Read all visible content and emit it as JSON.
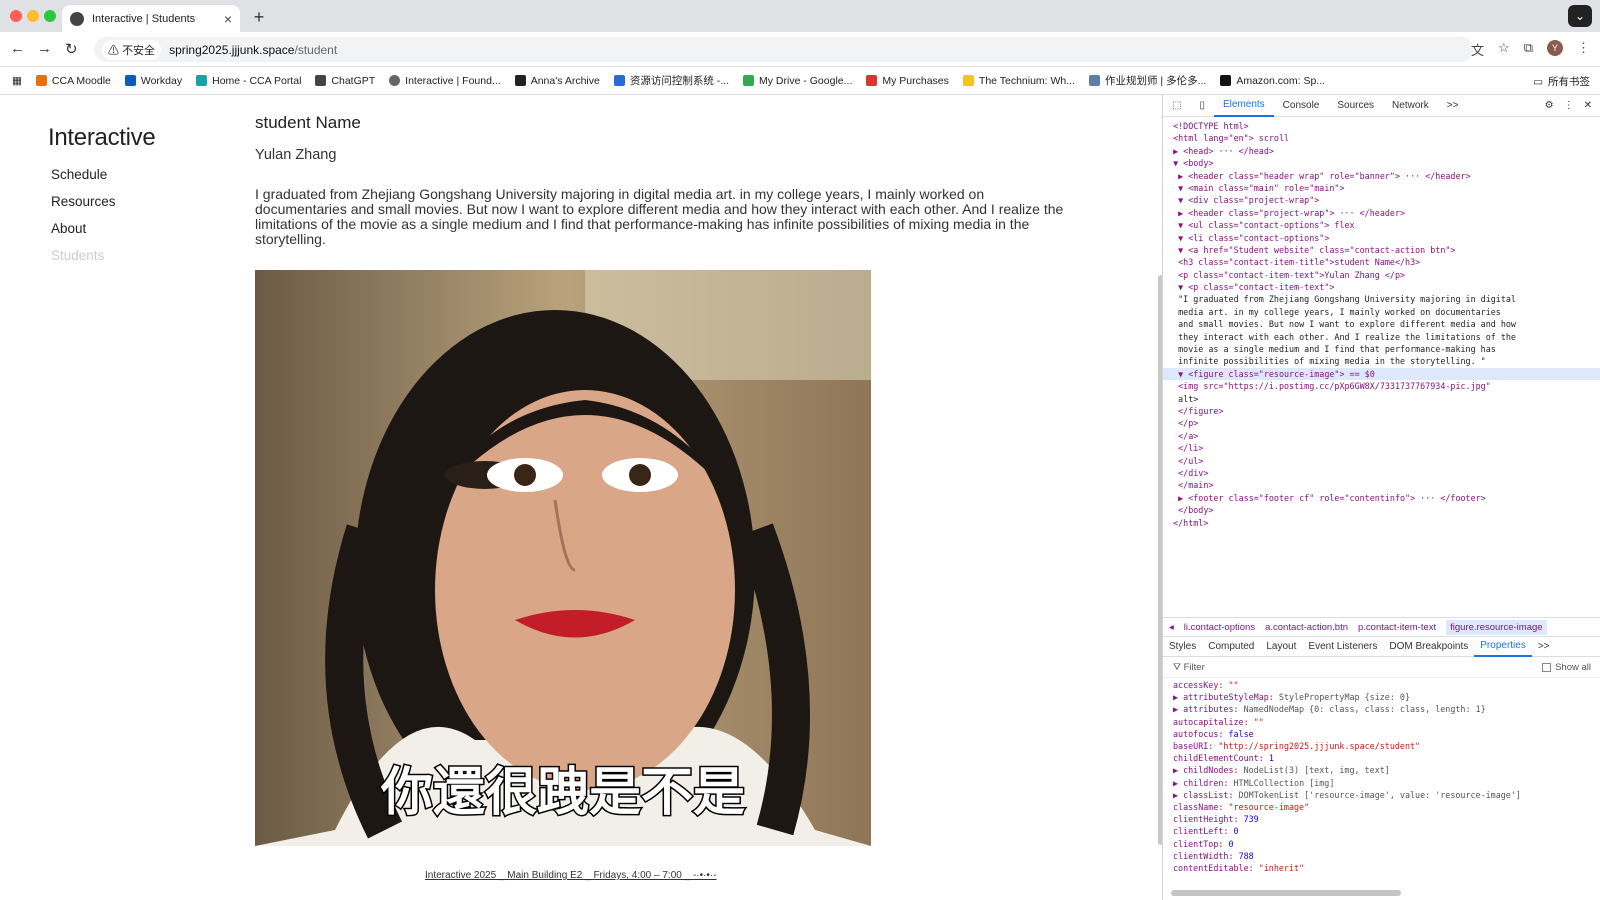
{
  "browser": {
    "tab_title": "Interactive | Students",
    "security_label": "不安全",
    "url_host": "spring2025.jjjunk.space",
    "url_path": "/student",
    "avatar_letter": "Y",
    "bookmarks": [
      "CCA Moodle",
      "Workday",
      "Home - CCA Portal",
      "ChatGPT",
      "Interactive | Found...",
      "Anna's Archive",
      "资源访问控制系统 -...",
      "My Drive - Google...",
      "My Purchases",
      "The Technium: Wh...",
      "作业规划师 | 多伦多...",
      "Amazon.com: Sp..."
    ],
    "all_bookmarks": "所有书签"
  },
  "site": {
    "logo": "Interactive",
    "nav": [
      "Schedule",
      "Resources",
      "About",
      "Students"
    ],
    "heading": "student Name",
    "student_name": "Yulan Zhang",
    "bio": "I graduated from Zhejiang Gongshang University majoring in digital media art. in my college years, I mainly worked on documentaries and small movies. But now I want to explore different media and how they interact with each other. And I realize the limitations of the movie as a single medium and I find that performance-making has infinite possibilities of mixing media in the storytelling.",
    "image_caption": "你還很跩是不是",
    "footer": "Interactive 2025 _ Main Building E2 _ Fridays, 4:00 – 7:00 _ -·•·•·-"
  },
  "devtools": {
    "tabs": [
      "Elements",
      "Console",
      "Sources",
      "Network"
    ],
    "more": ">>",
    "dom_lines": [
      "<!DOCTYPE html>",
      "<html lang=\"en\"> scroll",
      "▶ <head> ··· </head>",
      "▼ <body>",
      "  ▶ <header class=\"header wrap\" role=\"banner\"> ··· </header>",
      "  ▼ <main class=\"main\" role=\"main\">",
      "    ▼ <div class=\"project-wrap\">",
      "      ▶ <header class=\"project-wrap\"> ··· </header>",
      "      ▼ <ul class=\"contact-options\"> flex",
      "        ▼ <li class=\"contact-options\">",
      "          ▼ <a href=\"Student website\" class=\"contact-action btn\">",
      "              <h3 class=\"contact-item-title\">student Name</h3>",
      "              <p class=\"contact-item-text\">Yulan Zhang </p>",
      "            ▼ <p class=\"contact-item-text\">",
      "                \"I graduated from Zhejiang Gongshang University majoring in digital",
      "                media art. in my college years, I mainly worked on documentaries",
      "                and small movies. But now I want to explore different media and how",
      "                they interact with each other. And I realize the limitations of the",
      "                movie as a single medium and I find that performance-making has",
      "                infinite possibilities of mixing media in the storytelling. \"",
      "              ▼ <figure class=\"resource-image\"> == $0",
      "                  <img src=\"https://i.postimg.cc/pXp6GW8X/7331737767934-pic.jpg\"",
      "                  alt>",
      "                </figure>",
      "              </p>",
      "            </a>",
      "          </li>",
      "        </ul>",
      "      </div>",
      "    </main>",
      "  ▶ <footer class=\"footer cf\" role=\"contentinfo\"> ··· </footer>",
      "  </body>",
      "</html>"
    ],
    "breadcrumbs": [
      "li.contact-options",
      "a.contact-action.btn",
      "p.contact-item-text",
      "figure.resource-image"
    ],
    "panel_tabs": [
      "Styles",
      "Computed",
      "Layout",
      "Event Listeners",
      "DOM Breakpoints",
      "Properties"
    ],
    "filter_placeholder": "Filter",
    "show_all": "Show all",
    "properties": [
      [
        "accessKey: ",
        "\"\""
      ],
      [
        "▶ attributeStyleMap: ",
        "StylePropertyMap {size: 0}"
      ],
      [
        "▶ attributes: ",
        "NamedNodeMap {0: class, class: class, length: 1}"
      ],
      [
        "autocapitalize: ",
        "\"\""
      ],
      [
        "autofocus: ",
        "false"
      ],
      [
        "baseURI: ",
        "\"http://spring2025.jjjunk.space/student\""
      ],
      [
        "childElementCount: ",
        "1"
      ],
      [
        "▶ childNodes: ",
        "NodeList(3) [text, img, text]"
      ],
      [
        "▶ children: ",
        "HTMLCollection [img]"
      ],
      [
        "▶ classList: ",
        "DOMTokenList ['resource-image', value: 'resource-image']"
      ],
      [
        "className: ",
        "\"resource-image\""
      ],
      [
        "clientHeight: ",
        "739"
      ],
      [
        "clientLeft: ",
        "0"
      ],
      [
        "clientTop: ",
        "0"
      ],
      [
        "clientWidth: ",
        "788"
      ],
      [
        "contentEditable: ",
        "\"inherit\""
      ]
    ]
  },
  "colors": {
    "accent": "#1a73e8",
    "tag": "#881280",
    "attr": "#994500",
    "value": "#1a1aa6"
  }
}
